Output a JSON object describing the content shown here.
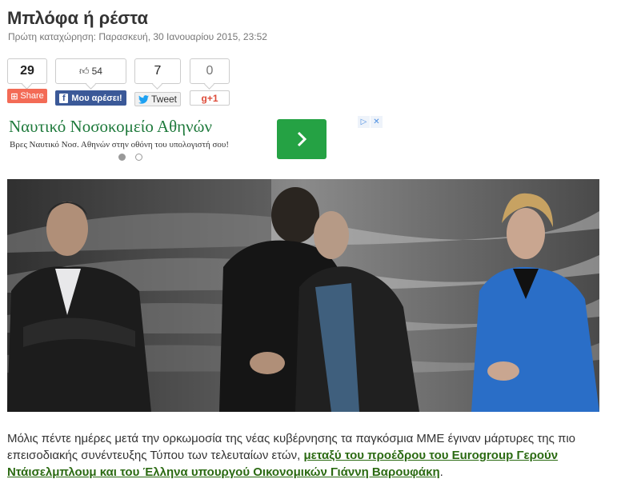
{
  "article": {
    "title": "Μπλόφα ή ρέστα",
    "pubdate": "Πρώτη καταχώρηση: Παρασκευή, 30 Ιανουαρίου 2015, 23:52",
    "paragraph_start": "Μόλις πέντε ημέρες μετά την ορκωμοσία της νέας κυβέρνησης τα παγκόσμια ΜΜΕ έγιναν μάρτυρες της πιο επεισοδιακής συνέντευξης Τύπου των τελευταίων ετών, ",
    "paragraph_link": "μεταξύ του προέδρου του Eurogroup Γερούν Ντάισελμπλουμ και του Έλληνα υπουργού Οικονομικών Γιάννη Βαρουφάκη",
    "paragraph_end": "."
  },
  "share": {
    "share_count": "29",
    "share_label": "Share",
    "like_count": "54",
    "like_label": "Μου αρέσει!",
    "tweet_count": "7",
    "tweet_label": "Tweet",
    "gplus_count": "0",
    "gplus_label": "+1"
  },
  "ad": {
    "title": "Ναυτικό Νοσοκομείο Αθηνών",
    "description": "Βρες Ναυτικό Νοσ. Αθηνών στην οθόνη του υπολογιστή σου!",
    "badge_icons": [
      "adchoices-icon",
      "close-icon"
    ],
    "arrow_icon": "chevron-right-icon"
  },
  "colors": {
    "share_button": "#f36b56",
    "facebook": "#3b5998",
    "ad_title": "#1f7a3c",
    "ad_button": "#25a244",
    "link": "#2b6a12"
  }
}
